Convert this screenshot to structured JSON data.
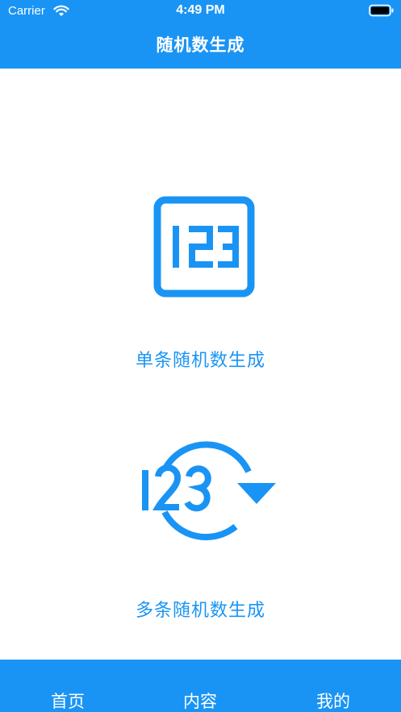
{
  "status_bar": {
    "carrier": "Carrier",
    "time": "4:49 PM",
    "icons": [
      "wifi-icon",
      "battery-icon"
    ]
  },
  "nav": {
    "title": "随机数生成"
  },
  "options": [
    {
      "label": "单条随机数生成",
      "icon": "number-box-icon",
      "icon_text": "123"
    },
    {
      "label": "多条随机数生成",
      "icon": "refresh-numbers-icon",
      "icon_text": "123"
    }
  ],
  "tabbar": {
    "tabs": [
      {
        "label": "首页"
      },
      {
        "label": "内容"
      },
      {
        "label": "我的"
      }
    ]
  },
  "colors": {
    "accent": "#1a94f4",
    "background": "#ffffff"
  }
}
